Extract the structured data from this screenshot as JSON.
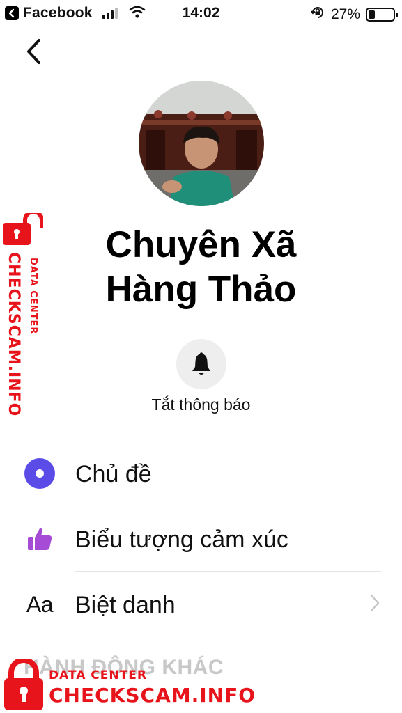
{
  "status_bar": {
    "back_app": "Facebook",
    "time": "14:02",
    "battery_percent": "27%",
    "battery_level": 0.27,
    "signal_bars": 3,
    "signal_bars_total": 4
  },
  "contact": {
    "name_line1": "Chuyên Xã",
    "name_line2": "Hàng Thảo"
  },
  "mute": {
    "label": "Tắt thông báo",
    "icon": "bell-icon"
  },
  "settings": [
    {
      "label": "Chủ đề",
      "icon": "theme-icon",
      "color": "#5b4ce8"
    },
    {
      "label": "Biểu tượng cảm xúc",
      "icon": "thumbs-up-icon",
      "color": "#a54bd6"
    },
    {
      "label": "Biệt danh",
      "icon": "nickname-icon",
      "icon_text": "Aa",
      "has_chevron": true
    }
  ],
  "sections": {
    "more_actions": "HÀNH ĐỘNG KHÁC"
  },
  "watermark": {
    "side_main": "CHECKSCAM.INFO",
    "side_sub": "DATA CENTER",
    "bottom_main": "CHECKSCAM.INFO",
    "bottom_sub": "DATA CENTER",
    "color": "#e8141b"
  }
}
